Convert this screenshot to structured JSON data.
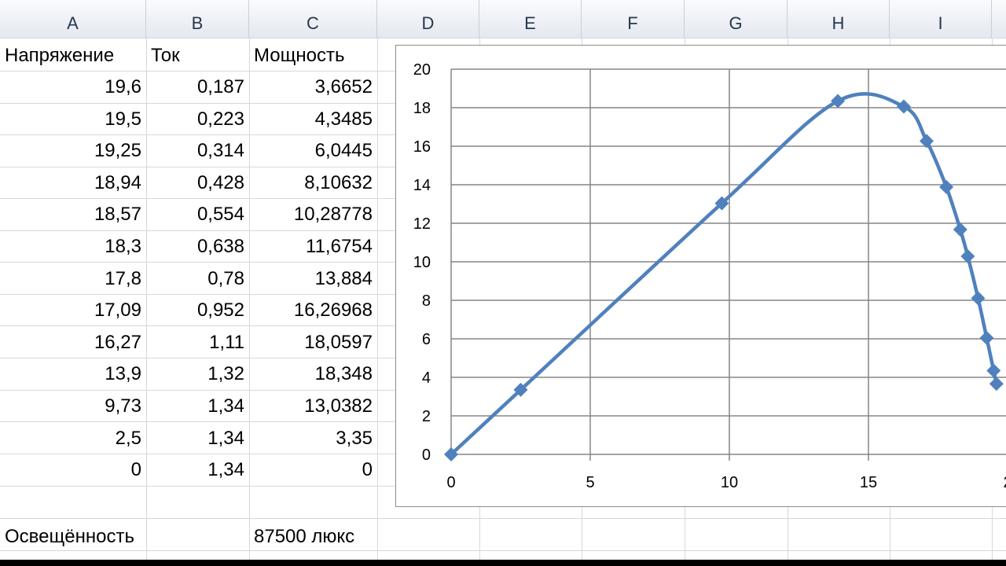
{
  "columns": [
    "A",
    "B",
    "C",
    "D",
    "E",
    "F",
    "G",
    "H",
    "I"
  ],
  "headers": {
    "voltage": "Напряжение",
    "current": "Ток",
    "power": "Мощность"
  },
  "rows": [
    [
      "19,6",
      "0,187",
      "3,6652"
    ],
    [
      "19,5",
      "0,223",
      "4,3485"
    ],
    [
      "19,25",
      "0,314",
      "6,0445"
    ],
    [
      "18,94",
      "0,428",
      "8,10632"
    ],
    [
      "18,57",
      "0,554",
      "10,28778"
    ],
    [
      "18,3",
      "0,638",
      "11,6754"
    ],
    [
      "17,8",
      "0,78",
      "13,884"
    ],
    [
      "17,09",
      "0,952",
      "16,26968"
    ],
    [
      "16,27",
      "1,11",
      "18,0597"
    ],
    [
      "13,9",
      "1,32",
      "18,348"
    ],
    [
      "9,73",
      "1,34",
      "13,0382"
    ],
    [
      "2,5",
      "1,34",
      "3,35"
    ],
    [
      "0",
      "1,34",
      "0"
    ]
  ],
  "footer": {
    "label": "Освещённость",
    "value": "87500 люкс"
  },
  "chart_data": {
    "type": "scatter",
    "smooth": true,
    "marker": "diamond",
    "color": "#4f81bd",
    "xlim": [
      0,
      20
    ],
    "ylim": [
      0,
      20
    ],
    "x_ticks": [
      "0",
      "5",
      "10",
      "15",
      "2"
    ],
    "y_ticks": [
      "0",
      "2",
      "4",
      "6",
      "8",
      "10",
      "12",
      "14",
      "16",
      "18",
      "20"
    ],
    "grid": true,
    "series": [
      {
        "x": [
          0,
          2.5,
          9.73,
          13.9,
          16.27,
          17.09,
          17.8,
          18.3,
          18.57,
          18.94,
          19.25,
          19.5,
          19.6
        ],
        "y": [
          0,
          3.35,
          13.0382,
          18.348,
          18.0597,
          16.26968,
          13.884,
          11.6754,
          10.28778,
          8.10632,
          6.0445,
          4.3485,
          3.6652
        ]
      }
    ]
  }
}
